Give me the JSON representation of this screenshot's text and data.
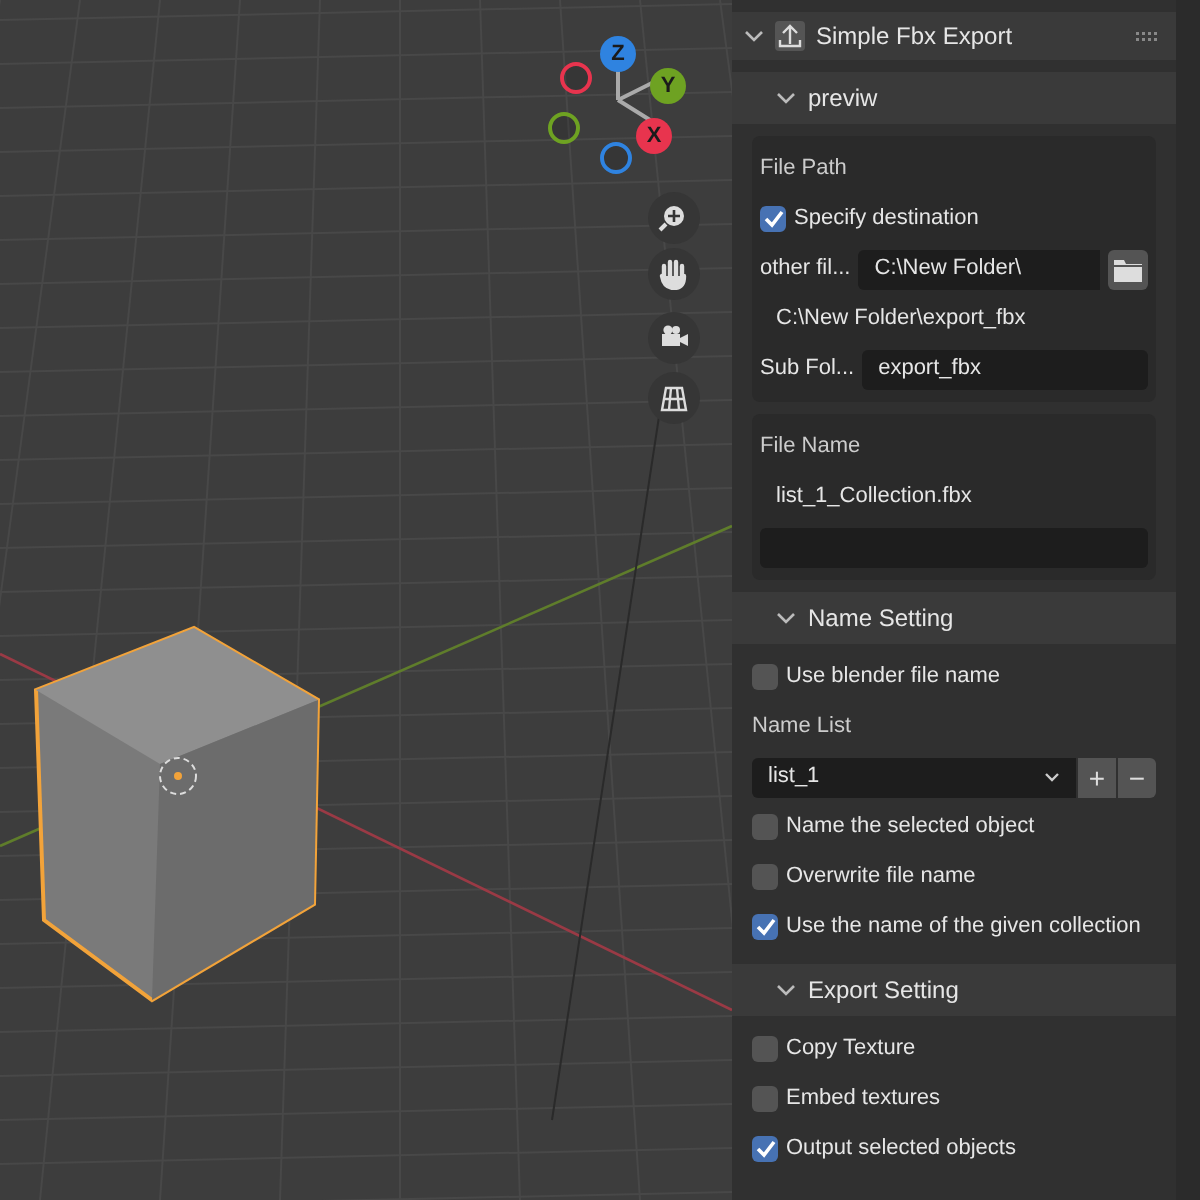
{
  "viewport": {
    "gizmo": [
      {
        "label": "Z",
        "color": "#2f83e0"
      },
      {
        "label": "Y",
        "color": "#6ea222"
      },
      {
        "label": "X",
        "color": "#e8344e"
      }
    ]
  },
  "panel": {
    "title": "Simple Fbx Export",
    "expanded": true,
    "rows": [
      {
        "kind": "header",
        "title": "previw",
        "expanded": true
      },
      {
        "kind": "box",
        "rows": [
          {
            "kind": "label",
            "text": "File Path"
          },
          {
            "kind": "checkbox",
            "text": "Specify destination",
            "checked": true
          },
          {
            "kind": "field",
            "label": "other fil...",
            "value": "C:\\New Folder\\",
            "browse": true
          },
          {
            "kind": "path",
            "text": "C:\\New Folder\\export_fbx"
          },
          {
            "kind": "field",
            "label": "Sub Fol...",
            "value": "export_fbx",
            "browse": false
          }
        ]
      },
      {
        "kind": "box",
        "rows": [
          {
            "kind": "label",
            "text": "File Name"
          },
          {
            "kind": "path",
            "text": "list_1_Collection.fbx"
          },
          {
            "kind": "field",
            "browse": false
          }
        ]
      },
      {
        "kind": "header",
        "title": "Name Setting",
        "expanded": true
      },
      {
        "kind": "checkbox",
        "text": "Use blender file name",
        "checked": false
      },
      {
        "kind": "label",
        "text": "Name List"
      },
      {
        "kind": "dropdown",
        "value": "list_1",
        "add": "+",
        "remove": "−"
      },
      {
        "kind": "checkbox",
        "text": "Name the selected object",
        "checked": false
      },
      {
        "kind": "checkbox",
        "text": "Overwrite file name",
        "checked": false
      },
      {
        "kind": "checkbox",
        "text": "Use the name of the given collection",
        "checked": true
      },
      {
        "kind": "header",
        "title": "Export Setting",
        "expanded": true
      },
      {
        "kind": "checkbox",
        "text": "Copy Texture",
        "checked": false
      },
      {
        "kind": "checkbox",
        "text": "Embed textures",
        "checked": false
      },
      {
        "kind": "checkbox",
        "text": "Output selected objects",
        "checked": true
      }
    ]
  }
}
